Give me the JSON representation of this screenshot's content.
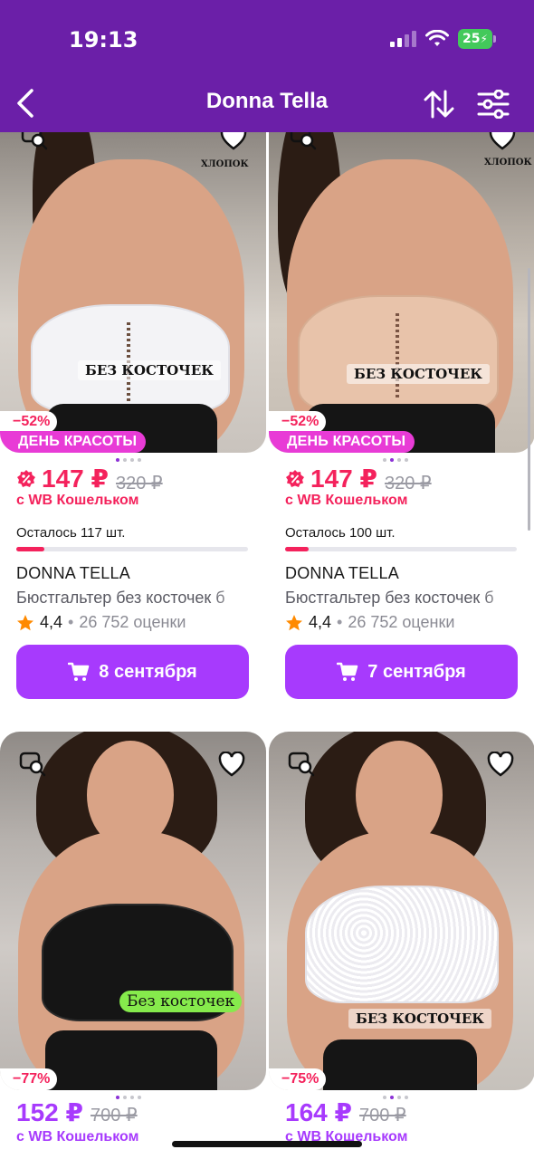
{
  "status_bar": {
    "time": "19:13",
    "battery": "25"
  },
  "header": {
    "title": "Donna Tella"
  },
  "cards": [
    {
      "discount": "−52%",
      "promo": "ДЕНЬ КРАСОТЫ",
      "image_label": "БЕЗ КОСТОЧЕК",
      "cotton_label": "ХЛОПОК",
      "price": "147 ₽",
      "old_price": "320 ₽",
      "wallet_note": "с WB Кошельком",
      "stock_text": "Осталось 117 шт.",
      "stock_fraction": 0.12,
      "brand": "DONNA TELLA",
      "title": "Бюстгальтер без косточек б",
      "rating": "4,4",
      "separator": "•",
      "reviews": "26 752 оценки",
      "delivery": "8 сентября"
    },
    {
      "discount": "−52%",
      "promo": "ДЕНЬ КРАСОТЫ",
      "image_label": "БЕЗ КОСТОЧЕК",
      "cotton_label": "ХЛОПОК",
      "price": "147 ₽",
      "old_price": "320 ₽",
      "wallet_note": "с WB Кошельком",
      "stock_text": "Осталось 100 шт.",
      "stock_fraction": 0.1,
      "brand": "DONNA TELLA",
      "title": "Бюстгальтер без косточек б",
      "rating": "4,4",
      "separator": "•",
      "reviews": "26 752 оценки",
      "delivery": "7 сентября"
    },
    {
      "discount": "−77%",
      "image_label": "Без косточек",
      "price": "152 ₽",
      "old_price": "700 ₽",
      "wallet_note": "с WB Кошельком"
    },
    {
      "discount": "−75%",
      "image_label": "БЕЗ КОСТОЧЕК",
      "price": "164 ₽",
      "old_price": "700 ₽",
      "wallet_note": "с WB Кошельком"
    }
  ],
  "colors": {
    "header_bg": "#6b1fa8",
    "accent": "#a73afd",
    "sale_red": "#f4225c",
    "promo_pink": "#e83bd6",
    "star": "#ff8a00"
  },
  "icons": [
    "back-arrow-icon",
    "sort-icon",
    "filter-icon",
    "image-search-icon",
    "heart-icon",
    "wallet-percent-icon",
    "star-icon",
    "cart-icon"
  ]
}
